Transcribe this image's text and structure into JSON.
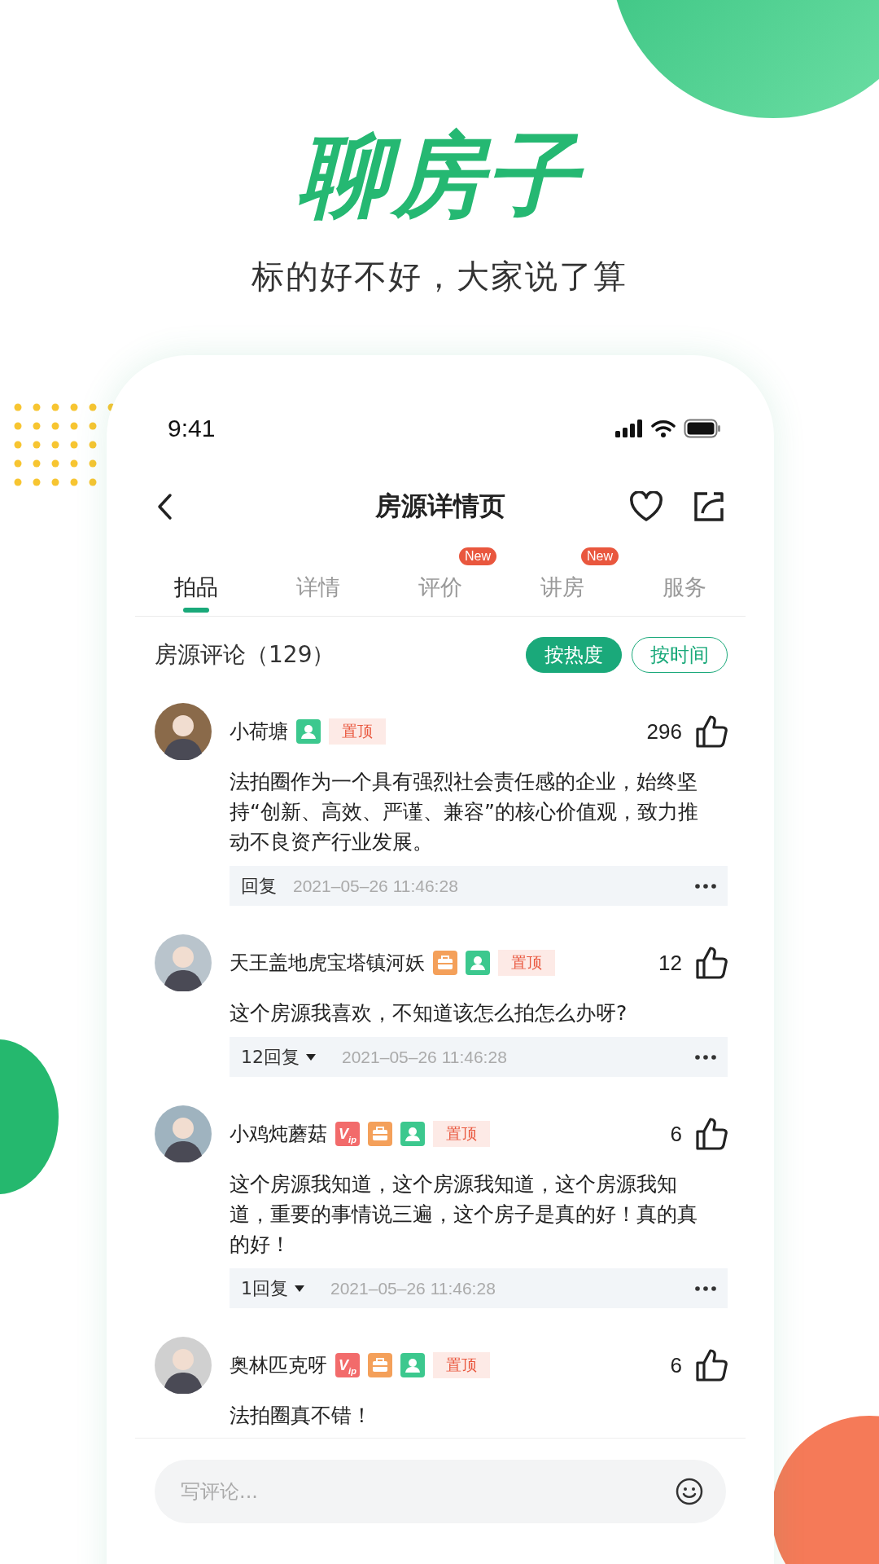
{
  "headline": "聊房子",
  "subtitle": "标的好不好，大家说了算",
  "status_bar": {
    "time": "9:41"
  },
  "nav": {
    "title": "房源详情页"
  },
  "tabs": [
    {
      "label": "拍品",
      "selected": true
    },
    {
      "label": "详情",
      "selected": false
    },
    {
      "label": "评价",
      "selected": false,
      "badge": "New"
    },
    {
      "label": "讲房",
      "selected": false,
      "badge": "New"
    },
    {
      "label": "服务",
      "selected": false
    }
  ],
  "comments_header": {
    "title": "房源评论（129）",
    "sort_buttons": [
      {
        "label": "按热度",
        "selected": true
      },
      {
        "label": "按时间",
        "selected": false
      }
    ]
  },
  "comments": [
    {
      "name": "小荷塘",
      "badges": [
        {
          "kind": "verified"
        },
        {
          "kind": "pinned",
          "text": "置顶"
        }
      ],
      "likes": "296",
      "text": "法拍圈作为一个具有强烈社会责任感的企业，始终坚持“创新、高效、严谨、兼容”的核心价值观，致力推动不良资产行业发展。",
      "reply": {
        "label": "回复",
        "expandable": false,
        "time": "2021–05–26 11:46:28"
      }
    },
    {
      "name": "天王盖地虎宝塔镇河妖",
      "badges": [
        {
          "kind": "work"
        },
        {
          "kind": "verified"
        },
        {
          "kind": "pinned",
          "text": "置顶"
        }
      ],
      "likes": "12",
      "text": "这个房源我喜欢，不知道该怎么拍怎么办呀?",
      "reply": {
        "label": "12回复",
        "expandable": true,
        "time": "2021–05–26 11:46:28"
      }
    },
    {
      "name": "小鸡炖蘑菇",
      "badges": [
        {
          "kind": "vip",
          "text": "V$_{ip}$"
        },
        {
          "kind": "work"
        },
        {
          "kind": "verified"
        },
        {
          "kind": "pinned",
          "text": "置顶"
        }
      ],
      "likes": "6",
      "text": "这个房源我知道，这个房源我知道，这个房源我知道，重要的事情说三遍，这个房子是真的好！真的真的好！",
      "reply": {
        "label": "1回复",
        "expandable": true,
        "time": "2021–05–26 11:46:28"
      }
    },
    {
      "name": "奥林匹克呀",
      "badges": [
        {
          "kind": "vip",
          "text": "V$_{ip}$"
        },
        {
          "kind": "work"
        },
        {
          "kind": "verified"
        },
        {
          "kind": "pinned",
          "text": "置顶"
        }
      ],
      "likes": "6",
      "text": "法拍圈真不错！"
    }
  ],
  "comment_input": {
    "placeholder": "写评论..."
  }
}
